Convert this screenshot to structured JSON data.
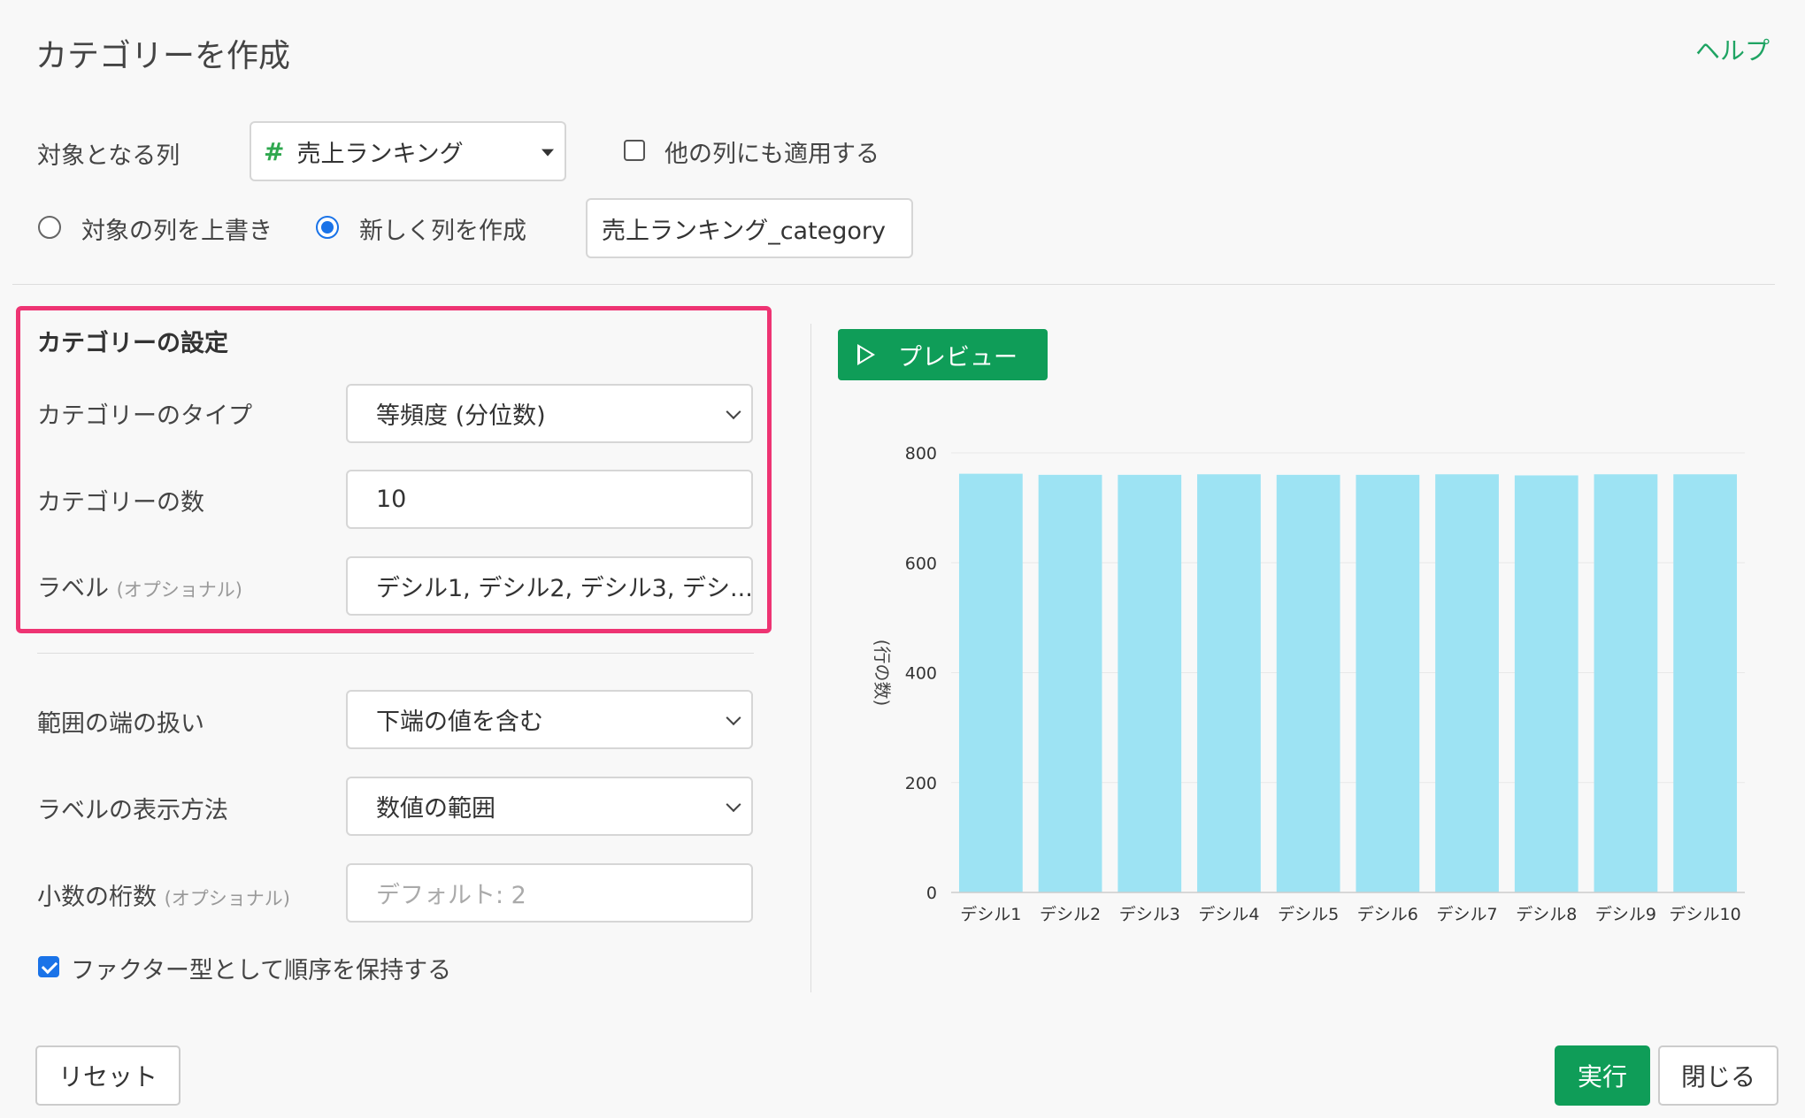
{
  "dialog": {
    "title": "カテゴリーを作成",
    "help": "ヘルプ"
  },
  "target": {
    "label": "対象となる列",
    "column_icon": "#",
    "column_value": "売上ランキング",
    "apply_others_label": "他の列にも適用する",
    "apply_others_checked": false
  },
  "output": {
    "overwrite_label": "対象の列を上書き",
    "new_column_label": "新しく列を作成",
    "selected": "new_column",
    "new_column_name": "売上ランキング_category"
  },
  "category_settings": {
    "heading": "カテゴリーの設定",
    "type_label": "カテゴリーのタイプ",
    "type_value": "等頻度 (分位数)",
    "count_label": "カテゴリーの数",
    "count_value": "10",
    "labels_label": "ラベル",
    "labels_optional": "(オプショナル)",
    "labels_value": "デシル1, デシル2, デシル3, デシ..."
  },
  "range": {
    "edge_label": "範囲の端の扱い",
    "edge_value": "下端の値を含む",
    "display_label": "ラベルの表示方法",
    "display_value": "数値の範囲",
    "decimals_label": "小数の桁数",
    "decimals_optional": "(オプショナル)",
    "decimals_placeholder": "デフォルト: 2",
    "factor_label": "ファクター型として順序を保持する",
    "factor_checked": true
  },
  "preview_button": "プレビュー",
  "footer": {
    "reset": "リセット",
    "run": "実行",
    "close": "閉じる"
  },
  "colors": {
    "accent_green": "#0f9d58",
    "highlight": "#ee3473",
    "bar": "#9de3f3",
    "link": "#1fa463"
  },
  "chart_data": {
    "type": "bar",
    "categories": [
      "デシル1",
      "デシル2",
      "デシル3",
      "デシル4",
      "デシル5",
      "デシル6",
      "デシル7",
      "デシル8",
      "デシル9",
      "デシル10"
    ],
    "values": [
      762,
      760,
      760,
      761,
      760,
      760,
      761,
      759,
      761,
      761
    ],
    "ylabel": "(行の数)",
    "ylim": [
      0,
      800
    ],
    "yticks": [
      0,
      200,
      400,
      600,
      800
    ],
    "grid": true
  }
}
